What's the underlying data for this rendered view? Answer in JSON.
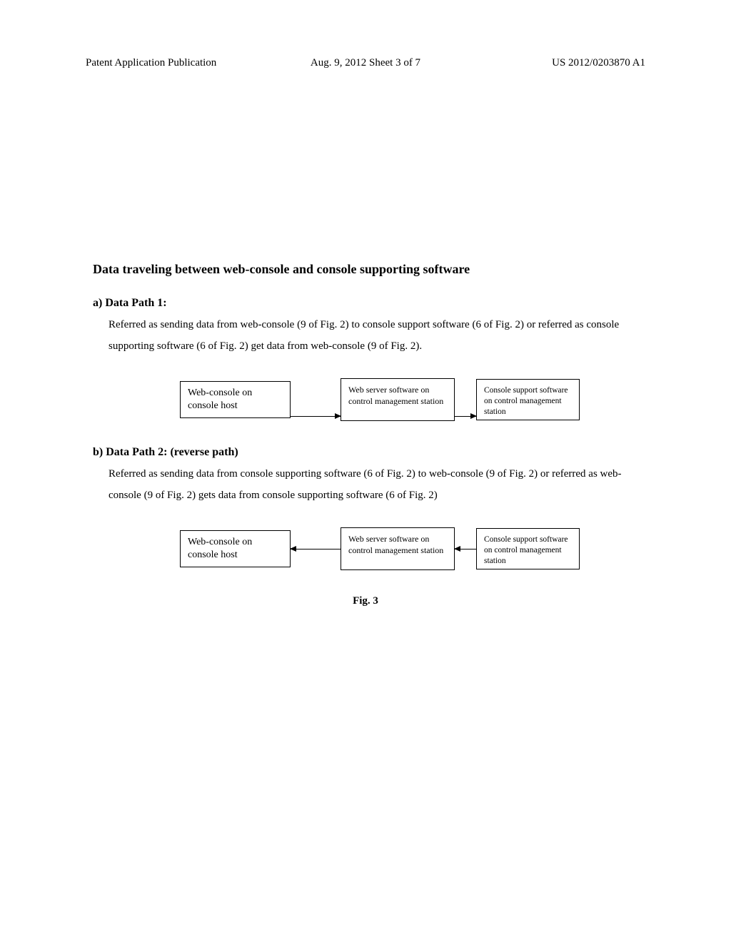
{
  "header": {
    "left": "Patent Application Publication",
    "center": "Aug. 9, 2012  Sheet 3 of 7",
    "right": "US 2012/0203870 A1"
  },
  "title": "Data traveling between web-console and console supporting software",
  "sections": {
    "a": {
      "heading": "a)  Data Path 1:",
      "body": "Referred as sending data from web-console  (9 of Fig. 2) to console support software (6 of Fig. 2) or referred as console supporting software (6 of Fig. 2) get data from web-console (9 of Fig. 2)."
    },
    "b": {
      "heading": "b) Data Path 2: (reverse path)",
      "body": "Referred as sending data from console supporting software (6 of Fig. 2) to web-console (9 of Fig. 2) or referred as web-console (9 of Fig. 2) gets data from console supporting software (6 of Fig. 2)"
    }
  },
  "diagram1": {
    "box1": "Web-console on console host",
    "box2": "Web server software on control management station",
    "box3": "Console support software on control management station"
  },
  "diagram2": {
    "box1": "Web-console on console host",
    "box2": "Web server software on control management station",
    "box3": "Console support software on control management station"
  },
  "figureCaption": "Fig. 3"
}
